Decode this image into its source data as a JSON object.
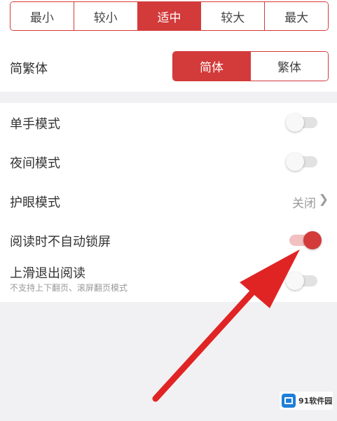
{
  "font_size": {
    "options": [
      "最小",
      "较小",
      "适中",
      "较大",
      "最大"
    ],
    "selected": "适中"
  },
  "script_setting": {
    "label": "简繁体",
    "options": [
      "简体",
      "繁体"
    ],
    "selected": "简体"
  },
  "settings": {
    "one_hand_mode": {
      "label": "单手模式",
      "enabled": false
    },
    "night_mode": {
      "label": "夜间模式",
      "enabled": false
    },
    "eye_care_mode": {
      "label": "护眼模式",
      "value": "关闭"
    },
    "no_auto_lock": {
      "label": "阅读时不自动锁屏",
      "enabled": true
    },
    "swipe_exit": {
      "label": "上滑退出阅读",
      "sublabel": "不支持上下翻页、滚屏翻页模式",
      "enabled": false
    }
  },
  "colors": {
    "accent": "#d33a3a",
    "arrow": "#e02424",
    "background": "#f1f1f3"
  },
  "watermark": {
    "logo_text": "91",
    "brand": "91软件园"
  },
  "icons": {
    "chevron": "chevron-right-icon",
    "arrow": "annotation-arrow-icon",
    "logo": "watermark-logo-icon"
  }
}
